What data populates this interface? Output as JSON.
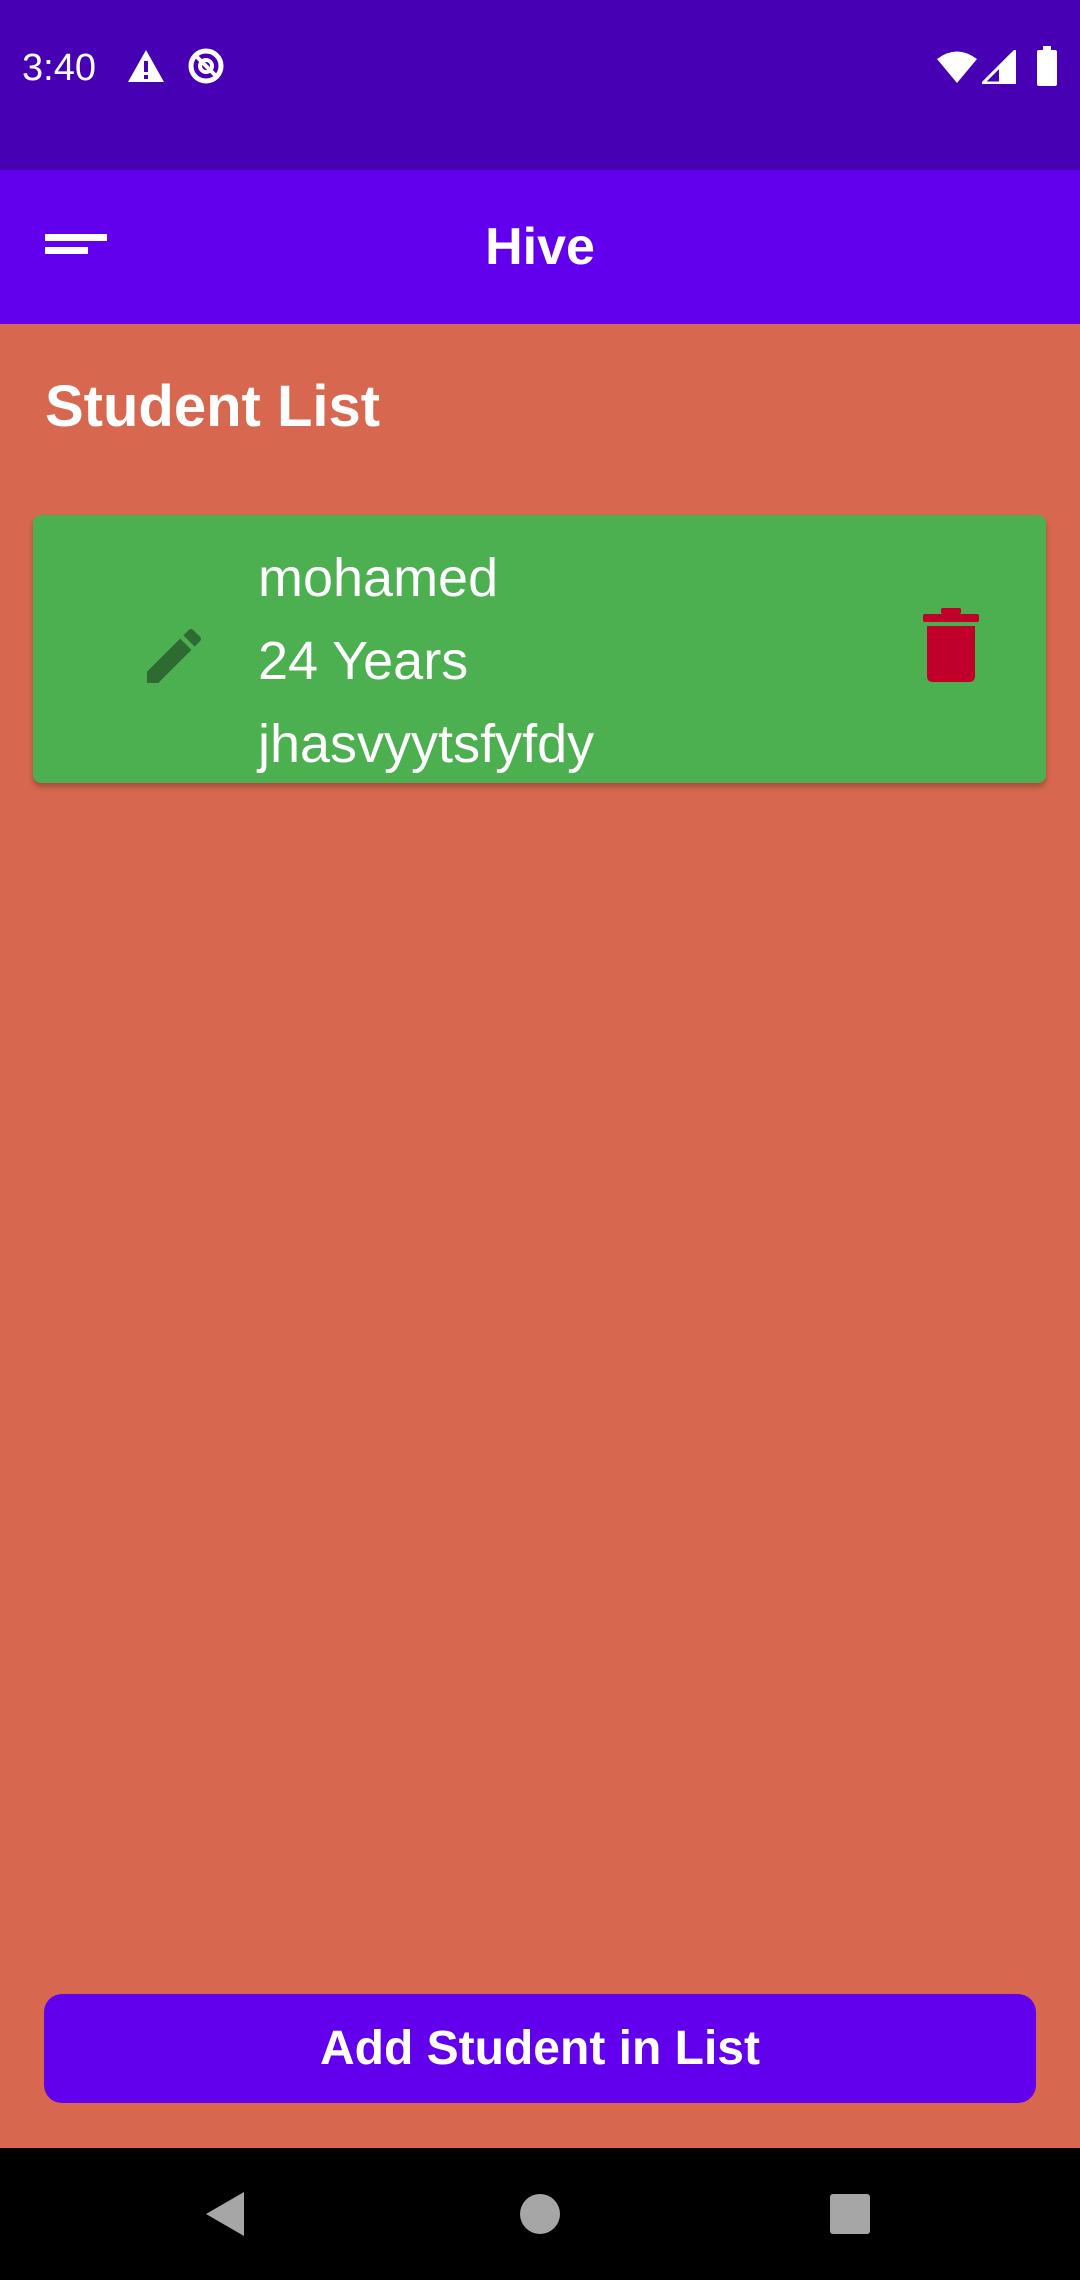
{
  "status_bar": {
    "time": "3:40",
    "left_icons": [
      "warning-icon",
      "data-saver-icon"
    ],
    "right_icons": [
      "wifi-icon",
      "cellular-signal-icon",
      "battery-icon"
    ],
    "background": "#4700B4"
  },
  "app_bar": {
    "title": "Hive",
    "menu_icon": "sort-menu-icon",
    "background": "#6200EE"
  },
  "main": {
    "section_title": "Student List",
    "background": "#D8674F",
    "students": [
      {
        "name": "mohamed",
        "age": "24 Years",
        "detail": "jhasvyytsfyfdy",
        "edit_icon": "edit-pencil-icon",
        "delete_icon": "trash-icon",
        "card_color": "#4CAF50",
        "edit_icon_color": "#2E6B30",
        "delete_icon_color": "#C0002A"
      }
    ]
  },
  "footer": {
    "add_button_label": "Add Student in List",
    "button_color": "#6200EE"
  },
  "nav_bar": {
    "items": [
      "back-icon",
      "home-icon",
      "recents-icon"
    ]
  }
}
